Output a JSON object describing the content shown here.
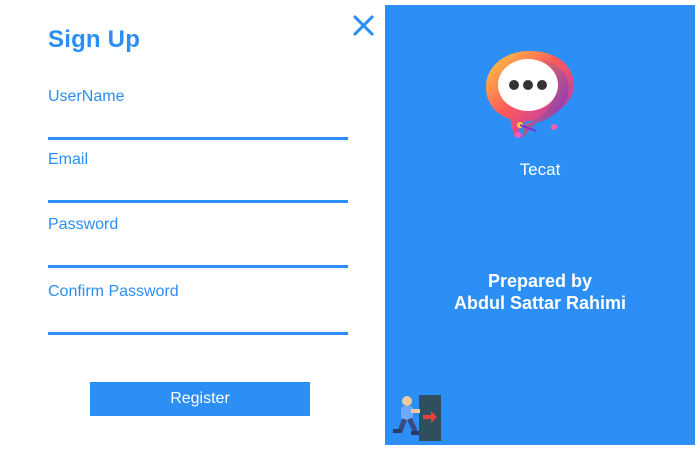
{
  "form": {
    "title": "Sign Up",
    "fields": [
      {
        "label": "UserName",
        "value": ""
      },
      {
        "label": "Email",
        "value": ""
      },
      {
        "label": "Password",
        "value": ""
      },
      {
        "label": "Confirm Password",
        "value": ""
      }
    ],
    "register_label": "Register"
  },
  "panel": {
    "app_name": "Tecat",
    "credit_line1": "Prepared by",
    "credit_line2": "Abdul Sattar Rahimi"
  },
  "icons": {
    "close": "close-icon",
    "logo": "chat-bubble-logo",
    "exit": "exit-door-icon"
  },
  "colors": {
    "accent": "#2b8ef2",
    "panel_bg": "#2c8ff5",
    "text_on_panel": "#ffffff"
  }
}
